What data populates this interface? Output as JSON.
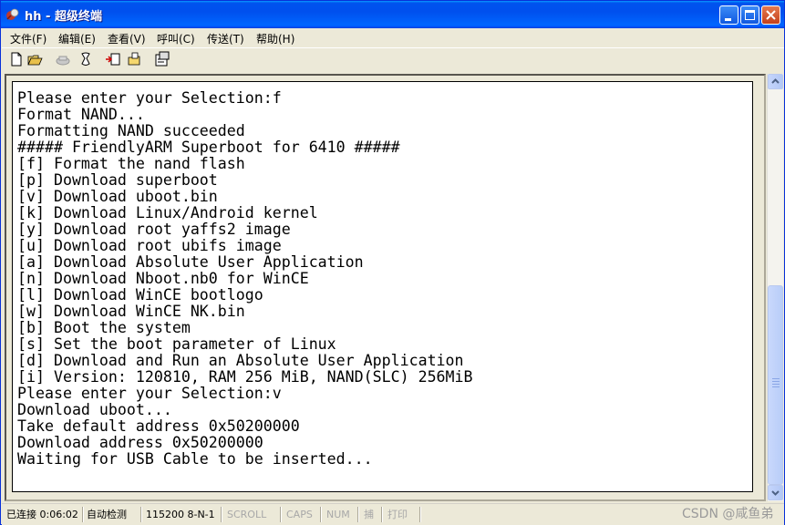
{
  "window": {
    "title": "hh - 超级终端"
  },
  "menu": [
    {
      "label": "文件(F)"
    },
    {
      "label": "编辑(E)"
    },
    {
      "label": "查看(V)"
    },
    {
      "label": "呼叫(C)"
    },
    {
      "label": "传送(T)"
    },
    {
      "label": "帮助(H)"
    }
  ],
  "toolbar": {
    "icons": [
      "new-document-icon",
      "open-folder-icon",
      "disconnect-icon",
      "dial-icon",
      "send-file-icon",
      "receive-file-icon",
      "properties-icon"
    ]
  },
  "terminal": {
    "lines": [
      "Please enter your Selection:f",
      "Format NAND...",
      "Formatting NAND succeeded",
      "##### FriendlyARM Superboot for 6410 #####",
      "[f] Format the nand flash",
      "[p] Download superboot",
      "[v] Download uboot.bin",
      "[k] Download Linux/Android kernel",
      "[y] Download root yaffs2 image",
      "[u] Download root ubifs image",
      "[a] Download Absolute User Application",
      "[n] Download Nboot.nb0 for WinCE",
      "[l] Download WinCE bootlogo",
      "[w] Download WinCE NK.bin",
      "[b] Boot the system",
      "[s] Set the boot parameter of Linux",
      "[d] Download and Run an Absolute User Application",
      "[i] Version: 120810, RAM 256 MiB, NAND(SLC) 256MiB",
      "Please enter your Selection:v",
      "Download uboot...",
      "Take default address 0x50200000",
      "Download address 0x50200000",
      "Waiting for USB Cable to be inserted..."
    ]
  },
  "status": {
    "connection": "已连接 0:06:02",
    "detect": "自动检测",
    "params": "115200 8-N-1",
    "scroll": "SCROLL",
    "caps": "CAPS",
    "num": "NUM",
    "capture": "捕",
    "print": "打印"
  },
  "watermark": "CSDN @咸鱼弟",
  "colors": {
    "titlebar": "#0053ee",
    "terminal_bg": "#ffffff",
    "terminal_fg": "#000000",
    "chrome": "#ece9d8"
  }
}
